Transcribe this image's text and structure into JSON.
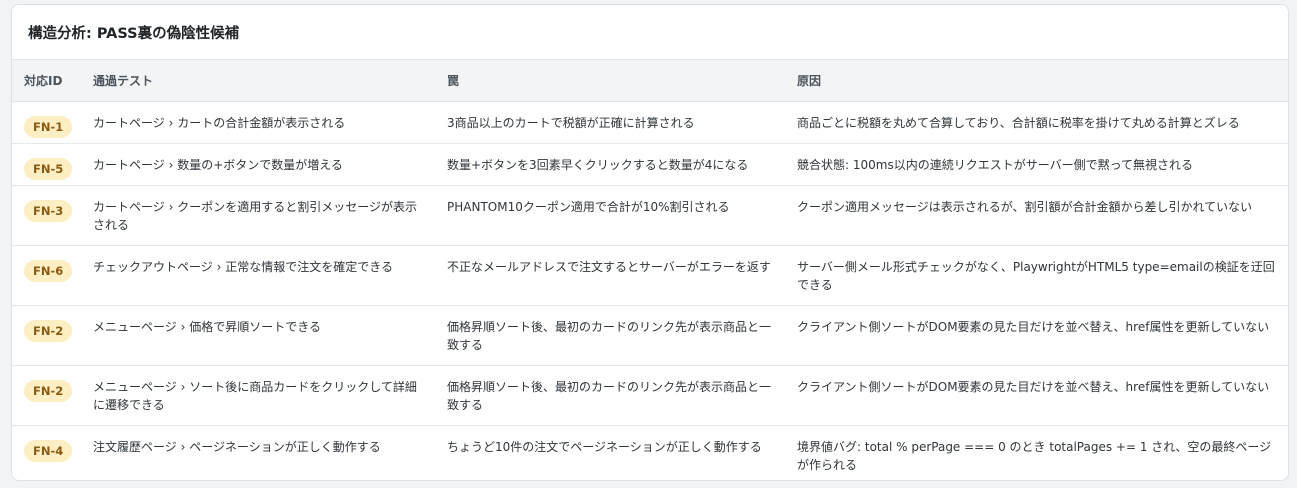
{
  "card": {
    "title": "構造分析: PASS裏の偽陰性候補"
  },
  "table": {
    "headers": [
      "対応ID",
      "通過テスト",
      "罠",
      "原因"
    ],
    "rows": [
      {
        "id": "FN-1",
        "test": "カートページ › カートの合計金額が表示される",
        "trap": "3商品以上のカートで税額が正確に計算される",
        "cause": "商品ごとに税額を丸めて合算しており、合計額に税率を掛けて丸める計算とズレる"
      },
      {
        "id": "FN-5",
        "test": "カートページ › 数量の+ボタンで数量が増える",
        "trap": "数量+ボタンを3回素早くクリックすると数量が4になる",
        "cause": "競合状態: 100ms以内の連続リクエストがサーバー側で黙って無視される"
      },
      {
        "id": "FN-3",
        "test": "カートページ › クーポンを適用すると割引メッセージが表示される",
        "trap": "PHANTOM10クーポン適用で合計が10%割引される",
        "cause": "クーポン適用メッセージは表示されるが、割引額が合計金額から差し引かれていない"
      },
      {
        "id": "FN-6",
        "test": "チェックアウトページ › 正常な情報で注文を確定できる",
        "trap": "不正なメールアドレスで注文するとサーバーがエラーを返す",
        "cause": "サーバー側メール形式チェックがなく、PlaywrightがHTML5 type=emailの検証を迂回できる"
      },
      {
        "id": "FN-2",
        "test": "メニューページ › 価格で昇順ソートできる",
        "trap": "価格昇順ソート後、最初のカードのリンク先が表示商品と一致する",
        "cause": "クライアント側ソートがDOM要素の見た目だけを並べ替え、href属性を更新していない"
      },
      {
        "id": "FN-2",
        "test": "メニューページ › ソート後に商品カードをクリックして詳細に遷移できる",
        "trap": "価格昇順ソート後、最初のカードのリンク先が表示商品と一致する",
        "cause": "クライアント側ソートがDOM要素の見た目だけを並べ替え、href属性を更新していない"
      },
      {
        "id": "FN-4",
        "test": "注文履歴ページ › ページネーションが正しく動作する",
        "trap": "ちょうど10件の注文でページネーションが正しく動作する",
        "cause": "境界値バグ: total % perPage === 0 のとき totalPages += 1 され、空の最終ページが作られる"
      }
    ]
  },
  "colors": {
    "badge_bg": "#fdefc3",
    "badge_text": "#8a5a12",
    "header_bg": "#f2f4f6"
  }
}
